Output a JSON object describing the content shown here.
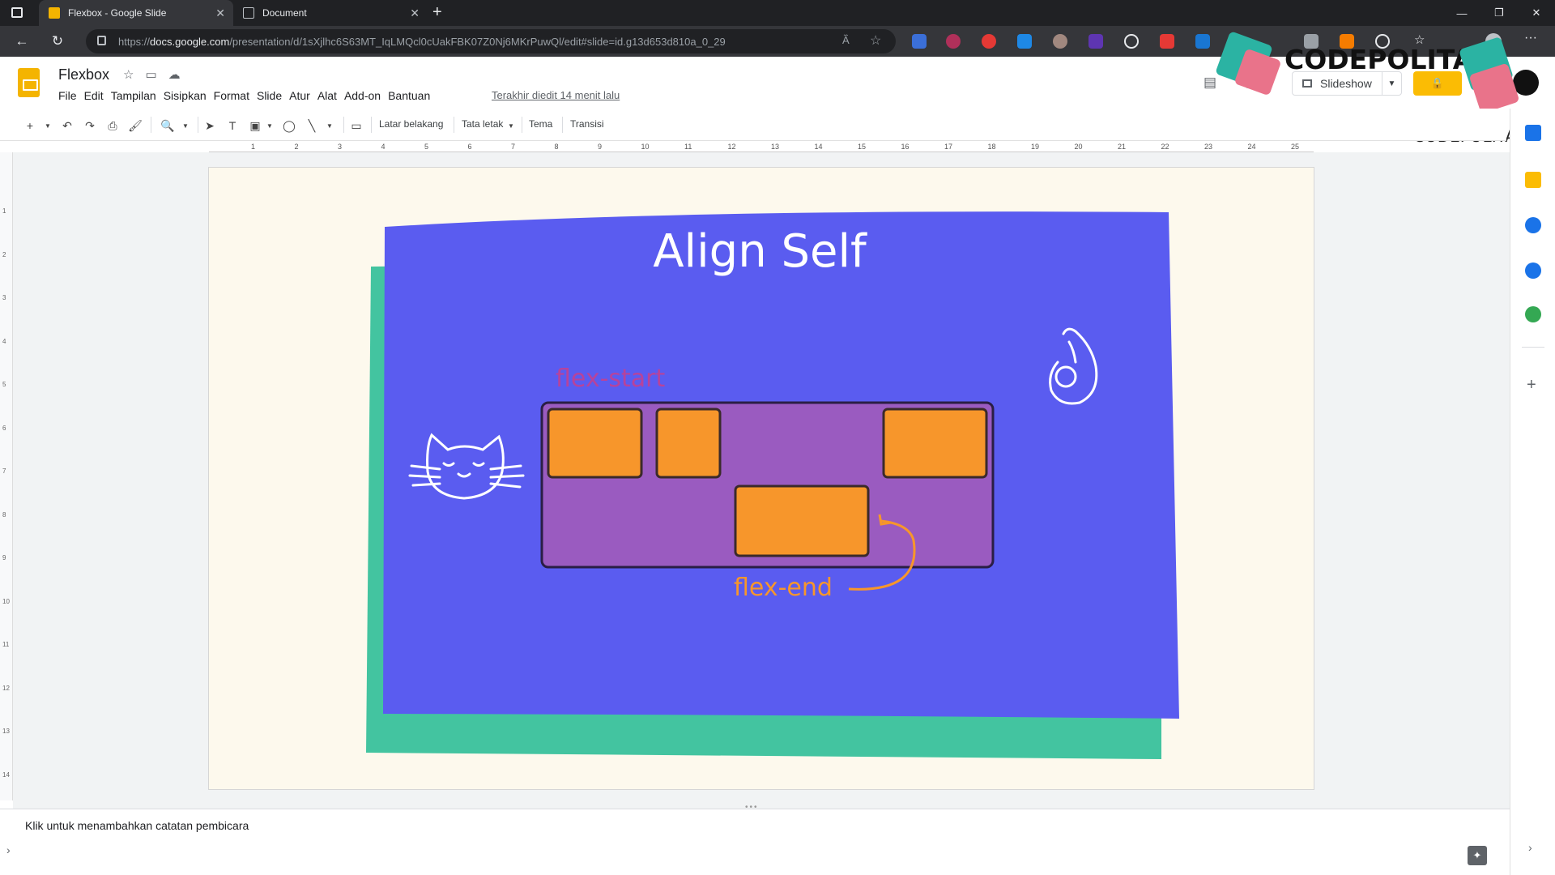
{
  "browser": {
    "tabs": [
      {
        "label": "Flexbox - Google Slide",
        "active": true
      },
      {
        "label": "Document",
        "active": false
      }
    ],
    "new_tab_icon": "+",
    "url_prefix": "https://",
    "url_host": "docs.google.com",
    "url_path": "/presentation/d/1sXjlhc6S63MT_IqLMQcl0cUakFBK07Z0Nj6MKrPuwQl/edit#slide=id.g13d653d810a_0_29"
  },
  "docs": {
    "title": "Flexbox",
    "menu": [
      "File",
      "Edit",
      "Tampilan",
      "Sisipkan",
      "Format",
      "Slide",
      "Atur",
      "Alat",
      "Add-on",
      "Bantuan"
    ],
    "last_edit": "Terakhir diedit 14 menit lalu",
    "slideshow_label": "Slideshow"
  },
  "toolbar": {
    "background": "Latar belakang",
    "layout": "Tata letak",
    "theme": "Tema",
    "transition": "Transisi"
  },
  "ruler": {
    "h_ticks": [
      "1",
      "2",
      "3",
      "4",
      "5",
      "6",
      "7",
      "8",
      "9",
      "10",
      "11",
      "12",
      "13",
      "14",
      "15",
      "16",
      "17",
      "18",
      "19",
      "20",
      "21",
      "22",
      "23",
      "24",
      "25"
    ],
    "v_ticks": [
      "1",
      "2",
      "3",
      "4",
      "5",
      "6",
      "7",
      "8",
      "9",
      "10",
      "11",
      "12",
      "13",
      "14"
    ]
  },
  "slide": {
    "title": "Align Self",
    "label_start": "flex-start",
    "label_end": "flex-end",
    "colors": {
      "paper": "#fdf9ed",
      "card": "#5a5cf0",
      "card_shadow": "#43c4a0",
      "container": "#9a5bc0",
      "item": "#f7962b",
      "label_start": "#b7439b",
      "label_end": "#f7962b"
    }
  },
  "watermark": {
    "brand": "CODEPOLITAN",
    "brand_small": "CODEPOLITAN"
  },
  "notes": {
    "placeholder": "Klik untuk menambahkan catatan pembicara"
  }
}
